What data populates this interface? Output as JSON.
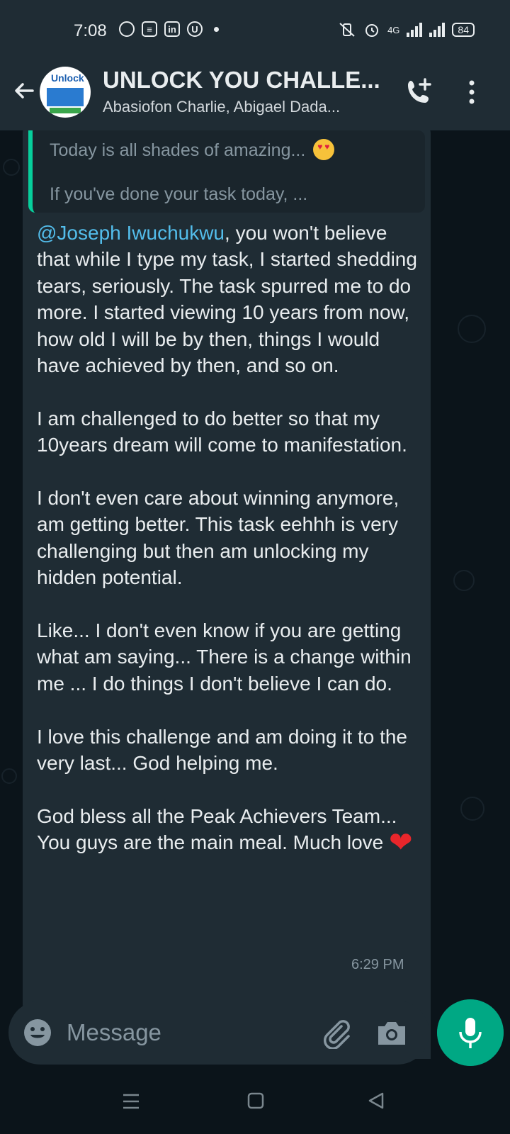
{
  "status_bar": {
    "time": "7:08",
    "network": "4G",
    "battery": "84"
  },
  "header": {
    "title": "UNLOCK YOU CHALLE...",
    "subtitle": "Abasiofon Charlie, Abigael Dada...",
    "avatar_text": "Unlock"
  },
  "quoted": {
    "line1": "Today is all shades of amazing...",
    "line2": "If you've done your task today, ..."
  },
  "message": {
    "mention": "@Joseph Iwuchukwu",
    "p1_rest": ", you won't believe that while I type my task, I started shedding tears, seriously. The task spurred me to do more. I started viewing 10 years from now, how old I will be by then, things I would have achieved by then, and so on.",
    "p2": "I am challenged to do better so that my 10years dream will come to manifestation.",
    "p3": "I don't even care about winning anymore, am getting better. This task eehhh is very challenging but then am unlocking my hidden potential.",
    "p4": "Like... I don't even know if you are getting what am saying... There is a change within me ... I do things I don't believe I can do.",
    "p5": "I love this challenge and am doing it to the very last... God helping me.",
    "p6": "God bless all the Peak Achievers Team... You guys are the main meal. Much love",
    "time": "6:29 PM"
  },
  "composer": {
    "placeholder": "Message"
  },
  "colors": {
    "header": "#1f2c34",
    "background": "#0b141a",
    "bubble": "#1f2c34",
    "accent": "#00a884",
    "mention": "#53bdeb"
  },
  "icons": [
    "back-arrow-icon",
    "add-call-icon",
    "more-vert-icon",
    "emoji-icon",
    "attach-icon",
    "camera-icon",
    "mic-icon",
    "scroll-down-icon"
  ]
}
